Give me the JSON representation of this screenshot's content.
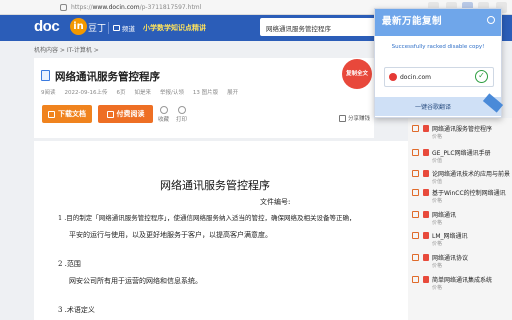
{
  "browser": {
    "url_scheme": "https://",
    "url_host": "www.docin.com",
    "url_path": "/p-3711817597.html"
  },
  "header": {
    "logo_text": "doc",
    "logo_in": "in",
    "logo_tail": "豆丁",
    "nav_home": "频道",
    "promo": "小学数学知识点精讲",
    "search_value": "网络通讯服务管控程序"
  },
  "breadcrumb": "机构内容 > IT-计算机 >",
  "document": {
    "title": "网络通讯服务管控程序",
    "badge": "复制全文",
    "meta": [
      "9阅读",
      "2022-09-16上传",
      "6页",
      "如是来",
      "举报/认领",
      "13 图片版",
      "展开"
    ],
    "download_label": "下载文档",
    "vip_label": "付费阅读",
    "favorite_label": "收藏",
    "print_label": "打印",
    "share_label": "分享赚钱"
  },
  "paper": {
    "title": "网络通讯服务管控程序",
    "file_no": "文件编号:",
    "line1": "1 .目的制定「网络通讯服务管控程序」，使通信网络服务纳入适当的管控，确保网络及相关设备等正确，",
    "line2": "平安的运行与使用，以及更好地服务于客户，以提高客户满意度。",
    "line3": "2 .范围",
    "line4": "网安公司所有用于运营的网络和信息系统。",
    "line5": "3 .术语定义"
  },
  "sidebar": {
    "items": [
      {
        "label": "网络通讯服务管控程序",
        "sub": "价格"
      },
      {
        "label": "GE_PLC网络通讯手册",
        "sub": "价值"
      },
      {
        "label": "论网络通讯技术的应用与前景",
        "sub": "价值"
      },
      {
        "label": "基于WinCC的控制网络通讯",
        "sub": "价格"
      },
      {
        "label": "网络通讯",
        "sub": "价格"
      },
      {
        "label": "LM_网络通讯",
        "sub": "价格"
      },
      {
        "label": "网络通讯协议",
        "sub": "价格"
      },
      {
        "label": "简单网络通讯集成系统",
        "sub": "价格"
      }
    ]
  },
  "extension": {
    "title": "最新万能复制",
    "message": "Successfully racked disable copy!",
    "site": "docin.com",
    "footer": "一键谷歌翻译",
    "colors": {
      "header": "#6fa6ea",
      "ok": "#2e9e41"
    }
  }
}
